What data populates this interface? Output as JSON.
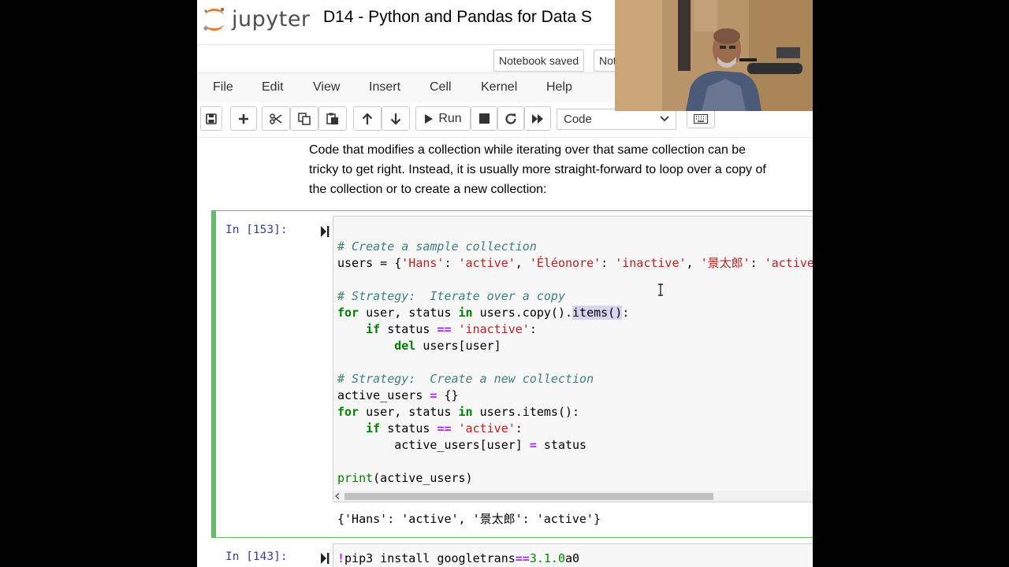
{
  "app": {
    "logo_text": "jupyter",
    "notebook_title": "D14 - Python and Pandas for Data S"
  },
  "status": {
    "saved": "Notebook saved",
    "trusted_partial": "Not"
  },
  "menu": [
    "File",
    "Edit",
    "View",
    "Insert",
    "Cell",
    "Kernel",
    "Help"
  ],
  "toolbar": {
    "run_label": "Run",
    "cell_type": "Code"
  },
  "markdown": {
    "line1": "Code that modifies a collection while iterating over that same collection can be",
    "line2": "tricky to get right. Instead, it is usually more straight-forward to loop over a copy of",
    "line3": "the collection or to create a new collection:"
  },
  "cell1": {
    "prompt": "In [153]:",
    "output": "{'Hans': 'active', '景太郎': 'active'}"
  },
  "cell2": {
    "prompt": "In [143]:"
  }
}
